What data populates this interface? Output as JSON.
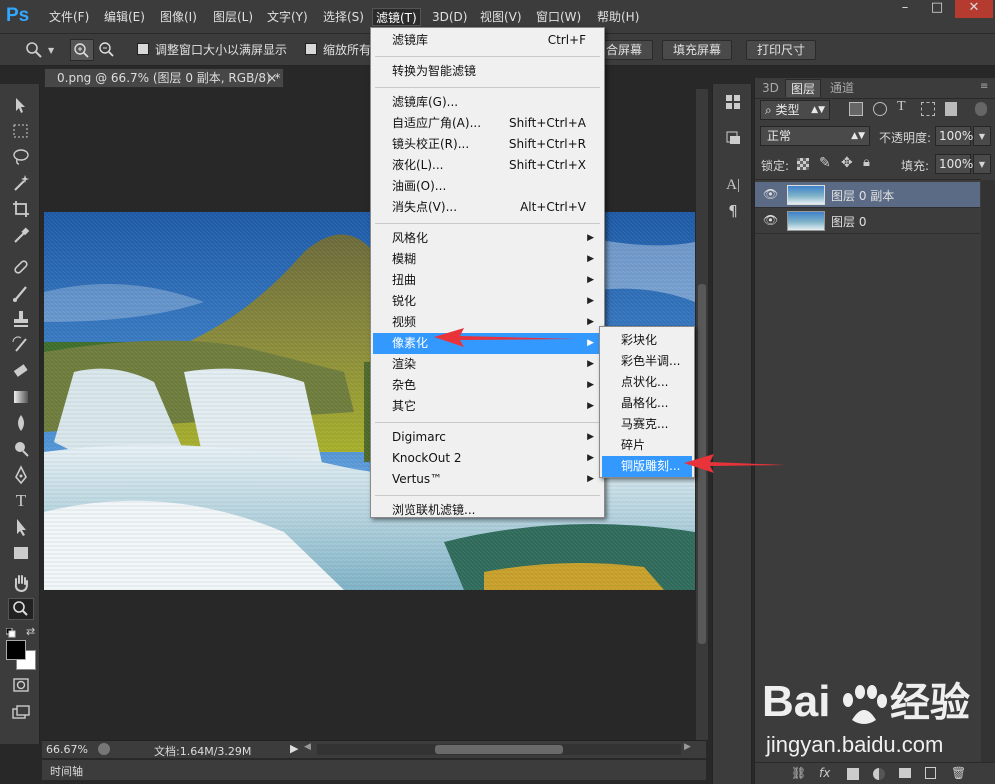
{
  "app": {
    "logo": "Ps"
  },
  "menubar": {
    "items": [
      "文件(F)",
      "编辑(E)",
      "图像(I)",
      "图层(L)",
      "文字(Y)",
      "选择(S)",
      "滤镜(T)",
      "3D(D)",
      "视图(V)",
      "窗口(W)",
      "帮助(H)"
    ],
    "active_index": 6
  },
  "window_controls": [
    "–",
    "□",
    "✕"
  ],
  "options_bar": {
    "resize_windows_label": "调整窗口大小以满屏显示",
    "zoom_all_label": "缩放所有",
    "fit_screen_label": "合屏幕",
    "fill_screen_label": "填充屏幕",
    "print_size_label": "打印尺寸"
  },
  "document": {
    "tab_title": "0.png @ 66.7% (图层 0 副本, RGB/8) *",
    "tab_close": "×"
  },
  "status": {
    "zoom": "66.67%",
    "doc_info": "文档:1.64M/3.29M"
  },
  "timeline": {
    "label": "时间轴"
  },
  "filter_menu": {
    "items": [
      {
        "label": "滤镜库",
        "shortcut": "Ctrl+F"
      },
      {
        "sep": true
      },
      {
        "label": "转换为智能滤镜"
      },
      {
        "sep": true
      },
      {
        "label": "滤镜库(G)..."
      },
      {
        "label": "自适应广角(A)...",
        "shortcut": "Shift+Ctrl+A"
      },
      {
        "label": "镜头校正(R)...",
        "shortcut": "Shift+Ctrl+R"
      },
      {
        "label": "液化(L)...",
        "shortcut": "Shift+Ctrl+X"
      },
      {
        "label": "油画(O)..."
      },
      {
        "label": "消失点(V)...",
        "shortcut": "Alt+Ctrl+V"
      },
      {
        "sep": true
      },
      {
        "label": "风格化",
        "submenu": true
      },
      {
        "label": "模糊",
        "submenu": true
      },
      {
        "label": "扭曲",
        "submenu": true
      },
      {
        "label": "锐化",
        "submenu": true
      },
      {
        "label": "视频",
        "submenu": true
      },
      {
        "label": "像素化",
        "submenu": true,
        "highlighted": true
      },
      {
        "label": "渲染",
        "submenu": true
      },
      {
        "label": "杂色",
        "submenu": true
      },
      {
        "label": "其它",
        "submenu": true
      },
      {
        "sep": true
      },
      {
        "label": "Digimarc",
        "submenu": true
      },
      {
        "label": "KnockOut 2",
        "submenu": true
      },
      {
        "label": "Vertus™",
        "submenu": true
      },
      {
        "sep": true
      },
      {
        "label": "浏览联机滤镜..."
      }
    ]
  },
  "pixelate_submenu": {
    "items": [
      {
        "label": "彩块化"
      },
      {
        "label": "彩色半调..."
      },
      {
        "label": "点状化..."
      },
      {
        "label": "晶格化..."
      },
      {
        "label": "马赛克..."
      },
      {
        "label": "碎片"
      },
      {
        "label": "铜版雕刻...",
        "highlighted": true
      }
    ]
  },
  "panels": {
    "tabs": [
      "3D",
      "图层",
      "通道"
    ],
    "active_tab": 1,
    "kind_filter": "类型",
    "blend_mode": "正常",
    "opacity_label": "不透明度:",
    "opacity_value": "100%",
    "lock_label": "锁定:",
    "fill_label": "填充:",
    "fill_value": "100%",
    "layers": [
      {
        "name": "图层 0 副本",
        "selected": true
      },
      {
        "name": "图层 0",
        "selected": false
      }
    ]
  },
  "watermark": {
    "brand": "Baidu",
    "brand_suffix": "经验",
    "url": "jingyan.baidu.com"
  },
  "colors": {
    "menu_highlight": "#3399ff",
    "annotation_arrow": "#e8333b",
    "ui_dark": "#3c3c3c",
    "canvas_bg": "#282828"
  }
}
